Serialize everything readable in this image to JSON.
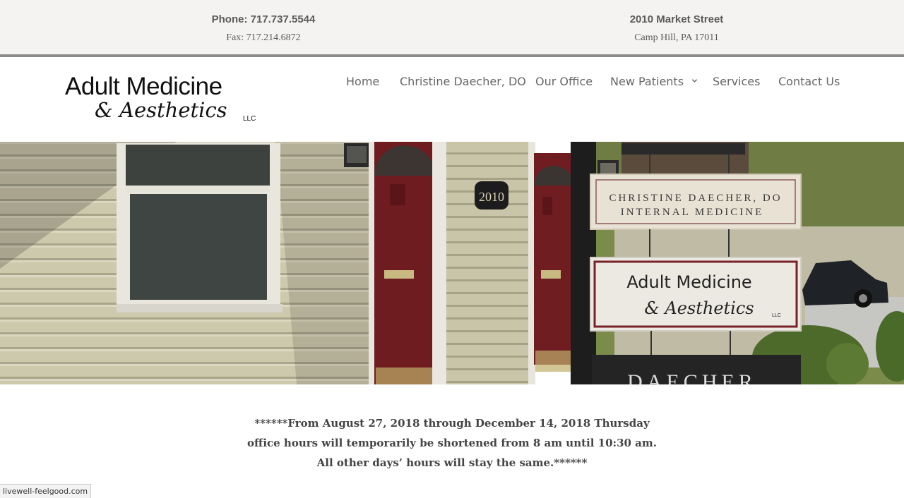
{
  "topbar": {
    "phone": "Phone: 717.737.5544",
    "fax": "Fax: 717.214.6872",
    "address_line1": "2010 Market Street",
    "address_line2": "Camp Hill, PA 17011"
  },
  "logo": {
    "line1": "Adult Medicine",
    "line2": "& Aesthetics",
    "suffix": "LLC"
  },
  "nav": {
    "items": [
      {
        "label": "Home"
      },
      {
        "label": "Christine Daecher, DO"
      },
      {
        "label": "Our Office"
      },
      {
        "label": "New Patients",
        "icon": "chevron-down-icon"
      },
      {
        "label": "Services"
      },
      {
        "label": "Contact Us"
      }
    ]
  },
  "hero": {
    "house_number": "2010",
    "sign_top_line1": "CHRISTINE DAECHER, DO",
    "sign_top_line2": "INTERNAL MEDICINE",
    "sign_bottom_line1": "Adult Medicine",
    "sign_bottom_line2": "& Aesthetics",
    "sign_bottom_suffix": "LLC",
    "lower_sign": "DAECHER"
  },
  "notice": {
    "line1": "******From August 27, 2018 through December 14, 2018 Thursday",
    "line2": "office hours will temporarily be shortened from 8 am until 10:30 am.",
    "line3": "All other days’ hours will stay the same.******"
  },
  "status_bar": {
    "url": "livewell-feelgood.com"
  },
  "colors": {
    "topbar_bg": "#f4f3f1",
    "topbar_border": "#8b8b8b",
    "nav_text": "#666666",
    "door_red": "#7a1f24",
    "siding": "#c7c3a6"
  }
}
